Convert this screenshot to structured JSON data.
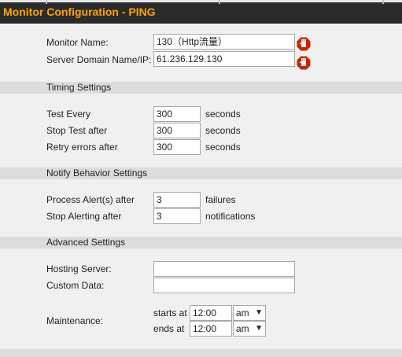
{
  "header": {
    "title": "Monitor Configuration - PING"
  },
  "monitor": {
    "name_label": "Monitor Name:",
    "name_value": "130（Http流量）",
    "domain_label": "Server Domain Name/IP:",
    "domain_value": "61.236.129.130"
  },
  "timing": {
    "section_title": "Timing Settings",
    "test_every_label": "Test Every",
    "test_every_value": "300",
    "test_every_unit": "seconds",
    "stop_test_label": "Stop Test after",
    "stop_test_value": "300",
    "stop_test_unit": "seconds",
    "retry_label": "Retry errors after",
    "retry_value": "300",
    "retry_unit": "seconds"
  },
  "notify": {
    "section_title": "Notify Behavior Settings",
    "process_label": "Process Alert(s) after",
    "process_value": "3",
    "process_unit": "failures",
    "stop_alert_label": "Stop Alerting after",
    "stop_alert_value": "3",
    "stop_alert_unit": "notifications"
  },
  "advanced": {
    "section_title": "Advanced Settings",
    "hosting_label": "Hosting Server:",
    "hosting_value": "",
    "custom_label": "Custom Data:",
    "custom_value": "",
    "maintenance_label": "Maintenance:",
    "starts_label": "starts at",
    "starts_time": "12:00",
    "starts_ampm": "am",
    "ends_label": "ends at",
    "ends_time": "12:00",
    "ends_ampm": "am",
    "arrow": "▼"
  },
  "colors": {
    "title": "#ffa500",
    "header_bg": "#2b2b2b",
    "stop_icon": "#cc2200"
  },
  "icons": {
    "required": "stop-hand-icon"
  }
}
